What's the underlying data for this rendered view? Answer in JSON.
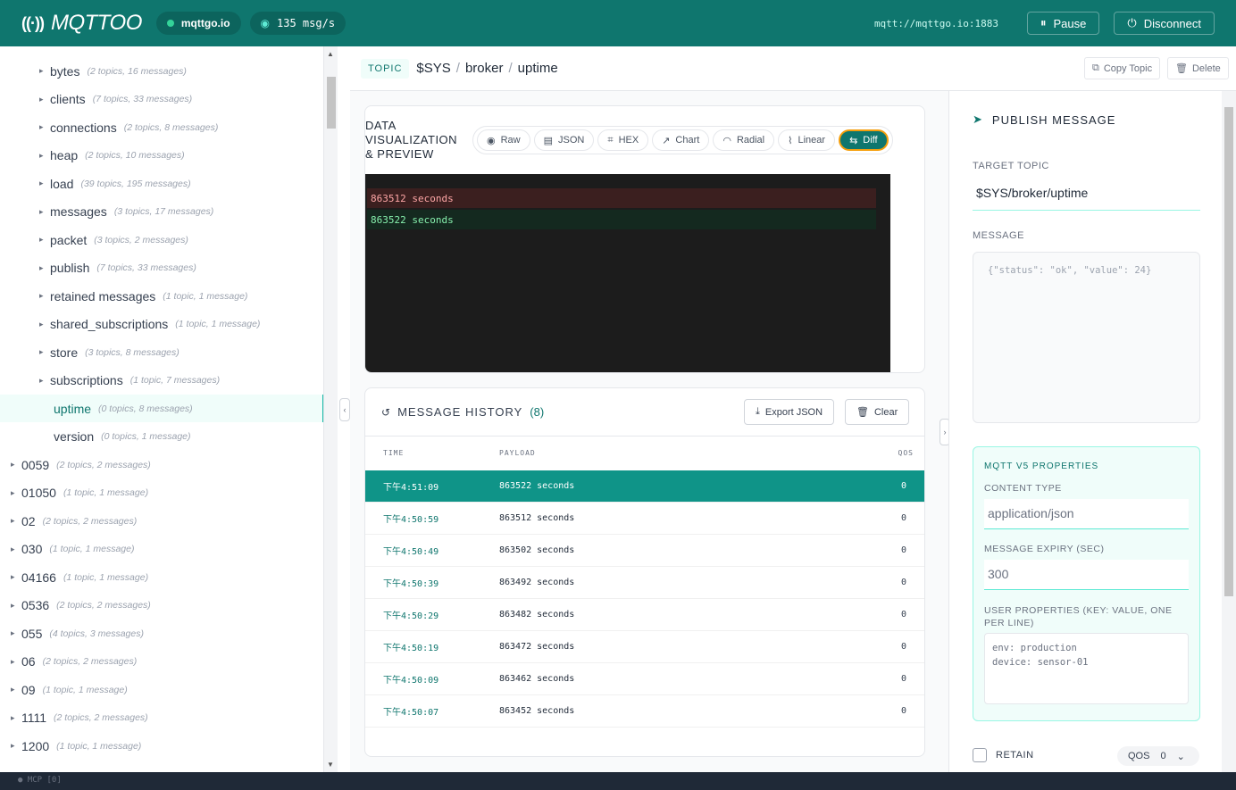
{
  "header": {
    "logo_text": "MQTTOO",
    "broker_name": "mqttgo.io",
    "rate": "135 msg/s",
    "broker_url": "mqtt://mqttgo.io:1883",
    "pause_label": "Pause",
    "disconnect_label": "Disconnect",
    "accent": "#0f766e"
  },
  "tree": {
    "rows": [
      {
        "name": "bytes",
        "meta": "(2 topics, 16 messages)"
      },
      {
        "name": "clients",
        "meta": "(7 topics, 33 messages)"
      },
      {
        "name": "connections",
        "meta": "(2 topics, 8 messages)"
      },
      {
        "name": "heap",
        "meta": "(2 topics, 10 messages)"
      },
      {
        "name": "load",
        "meta": "(39 topics, 195 messages)"
      },
      {
        "name": "messages",
        "meta": "(3 topics, 17 messages)"
      },
      {
        "name": "packet",
        "meta": "(3 topics, 2 messages)"
      },
      {
        "name": "publish",
        "meta": "(7 topics, 33 messages)"
      },
      {
        "name": "retained messages",
        "meta": "(1 topic, 1 message)"
      },
      {
        "name": "shared_subscriptions",
        "meta": "(1 topic, 1 message)"
      },
      {
        "name": "store",
        "meta": "(3 topics, 8 messages)"
      },
      {
        "name": "subscriptions",
        "meta": "(1 topic, 7 messages)"
      },
      {
        "name": "uptime",
        "meta": "(0 topics, 8 messages)"
      },
      {
        "name": "version",
        "meta": "(0 topics, 1 message)"
      },
      {
        "name": "0059",
        "meta": "(2 topics, 2 messages)"
      },
      {
        "name": "01050",
        "meta": "(1 topic, 1 message)"
      },
      {
        "name": "02",
        "meta": "(2 topics, 2 messages)"
      },
      {
        "name": "030",
        "meta": "(1 topic, 1 message)"
      },
      {
        "name": "04166",
        "meta": "(1 topic, 1 message)"
      },
      {
        "name": "0536",
        "meta": "(2 topics, 2 messages)"
      },
      {
        "name": "055",
        "meta": "(4 topics, 3 messages)"
      },
      {
        "name": "06",
        "meta": "(2 topics, 2 messages)"
      },
      {
        "name": "09",
        "meta": "(1 topic, 1 message)"
      },
      {
        "name": "1111",
        "meta": "(2 topics, 2 messages)"
      },
      {
        "name": "1200",
        "meta": "(1 topic, 1 message)"
      }
    ]
  },
  "topic": {
    "chip": "TOPIC",
    "path": [
      "$SYS",
      "broker",
      "uptime"
    ],
    "sep": "/",
    "copy_label": "Copy Topic",
    "delete_label": "Delete"
  },
  "viz": {
    "title": "DATA VISUALIZATION & PREVIEW",
    "modes": [
      "Raw",
      "JSON",
      "HEX",
      "Chart",
      "Radial",
      "Linear",
      "Diff"
    ],
    "active_mode": "Diff",
    "diff_old": "863512 seconds",
    "diff_new": "863522 seconds"
  },
  "history": {
    "title": "MESSAGE HISTORY",
    "count": "(8)",
    "export_label": "Export JSON",
    "clear_label": "Clear",
    "col_time": "TIME",
    "col_payload": "PAYLOAD",
    "col_qos": "QOS",
    "rows": [
      {
        "time": "下午4:51:09",
        "payload": "863522 seconds",
        "qos": "0"
      },
      {
        "time": "下午4:50:59",
        "payload": "863512 seconds",
        "qos": "0"
      },
      {
        "time": "下午4:50:49",
        "payload": "863502 seconds",
        "qos": "0"
      },
      {
        "time": "下午4:50:39",
        "payload": "863492 seconds",
        "qos": "0"
      },
      {
        "time": "下午4:50:29",
        "payload": "863482 seconds",
        "qos": "0"
      },
      {
        "time": "下午4:50:19",
        "payload": "863472 seconds",
        "qos": "0"
      },
      {
        "time": "下午4:50:09",
        "payload": "863462 seconds",
        "qos": "0"
      },
      {
        "time": "下午4:50:07",
        "payload": "863452 seconds",
        "qos": "0"
      }
    ]
  },
  "publish": {
    "title": "PUBLISH MESSAGE",
    "target_label": "TARGET TOPIC",
    "target_value": "$SYS/broker/uptime",
    "message_label": "MESSAGE",
    "message_placeholder": "{\"status\": \"ok\", \"value\": 24}",
    "v5_title": "MQTT V5 PROPERTIES",
    "content_type_label": "CONTENT TYPE",
    "content_type_placeholder": "application/json",
    "expiry_label": "MESSAGE EXPIRY (SEC)",
    "expiry_placeholder": "300",
    "user_props_label": "USER PROPERTIES (KEY: VALUE, ONE PER LINE)",
    "user_props_placeholder": "env: production\ndevice: sensor-01",
    "retain_label": "RETAIN",
    "qos_label": "QOS",
    "qos_value": "0"
  },
  "statusbar": {
    "text": "● MCP [0]"
  }
}
